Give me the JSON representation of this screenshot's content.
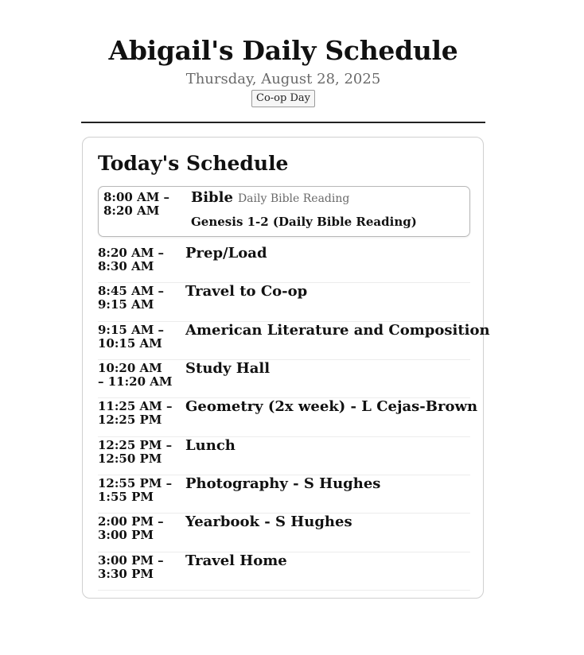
{
  "header": {
    "title": "Abigail's Daily Schedule",
    "date": "Thursday, August 28, 2025",
    "day_type": "Co-op Day"
  },
  "schedule": {
    "heading": "Today's Schedule",
    "current": {
      "time_start": "8:00 AM –",
      "time_end": "8:20 AM",
      "activity": "Bible",
      "note": "Daily Bible Reading",
      "reading": "Genesis 1-2 (Daily Bible Reading)"
    },
    "items": [
      {
        "time_start": "8:20 AM –",
        "time_end": "8:30 AM",
        "activity": "Prep/Load"
      },
      {
        "time_start": "8:45 AM –",
        "time_end": "9:15 AM",
        "activity": "Travel to Co-op"
      },
      {
        "time_start": "9:15 AM –",
        "time_end": "10:15 AM",
        "activity": "American Literature and Composition"
      },
      {
        "time_start": "10:20 AM",
        "time_end": "– 11:20 AM",
        "activity": "Study Hall"
      },
      {
        "time_start": "11:25 AM –",
        "time_end": "12:25 PM",
        "activity": "Geometry (2x week) - L Cejas-Brown"
      },
      {
        "time_start": "12:25 PM –",
        "time_end": "12:50 PM",
        "activity": "Lunch"
      },
      {
        "time_start": "12:55 PM –",
        "time_end": "1:55 PM",
        "activity": "Photography - S Hughes"
      },
      {
        "time_start": "2:00 PM –",
        "time_end": "3:00 PM",
        "activity": "Yearbook - S Hughes"
      },
      {
        "time_start": "3:00 PM –",
        "time_end": "3:30 PM",
        "activity": "Travel Home"
      }
    ]
  }
}
